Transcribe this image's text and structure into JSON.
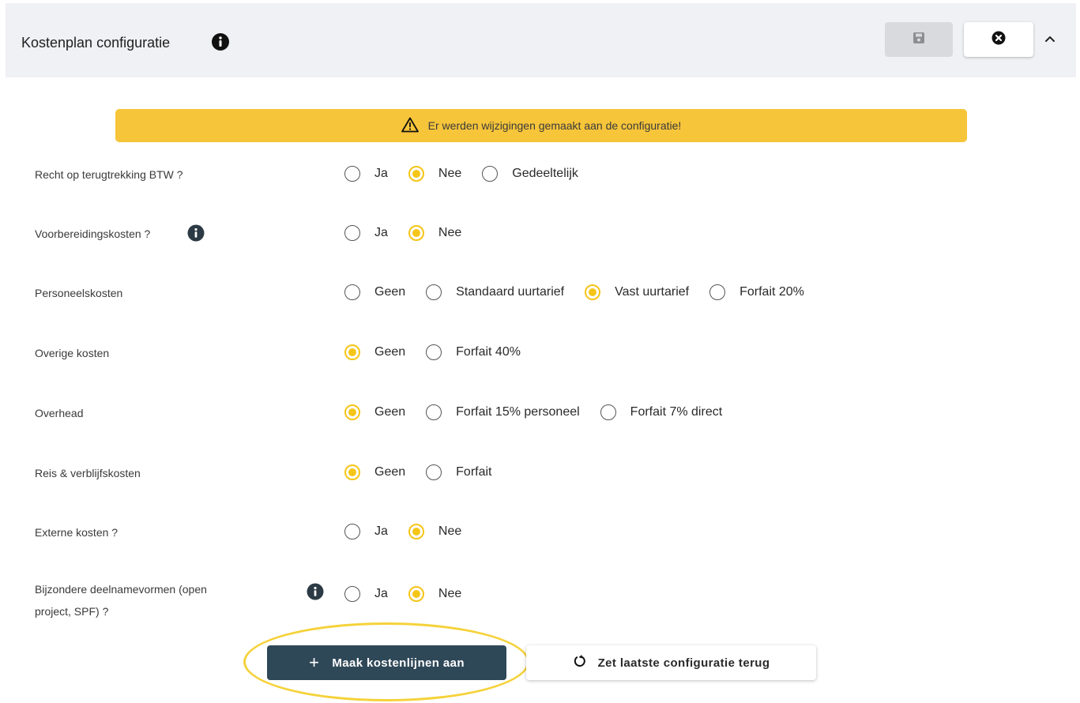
{
  "header": {
    "title": "Kostenplan configuratie",
    "icons": {
      "info": "info-circle-icon",
      "save": "floppy-disk-icon",
      "close": "close-circle-icon",
      "collapse": "chevron-up-icon"
    }
  },
  "warning": {
    "text": "Er werden wijzigingen gemaakt aan de configuratie!",
    "icon": "warning-triangle-icon",
    "color": "#f7c53a"
  },
  "colors": {
    "accent": "#f5c518",
    "primary_button": "#2f4858"
  },
  "rows": [
    {
      "label": "Recht op terugtrekking BTW ?",
      "options": [
        "Ja",
        "Nee",
        "Gedeeltelijk"
      ],
      "selected": "Nee"
    },
    {
      "label": "Voorbereidingskosten ?",
      "options": [
        "Ja",
        "Nee"
      ],
      "selected": "Nee"
    },
    {
      "label": "Personeelskosten",
      "options": [
        "Geen",
        "Standaard uurtarief",
        "Vast uurtarief",
        "Forfait 20%"
      ],
      "selected": "Vast uurtarief"
    },
    {
      "label": "Overige kosten",
      "options": [
        "Geen",
        "Forfait 40%"
      ],
      "selected": "Geen"
    },
    {
      "label": "Overhead",
      "options": [
        "Geen",
        "Forfait 15% personeel",
        "Forfait 7% direct"
      ],
      "selected": "Geen"
    },
    {
      "label": "Reis & verblijfskosten",
      "options": [
        "Geen",
        "Forfait"
      ],
      "selected": "Geen"
    },
    {
      "label": "Externe kosten ?",
      "options": [
        "Ja",
        "Nee"
      ],
      "selected": "Nee"
    },
    {
      "label_line1": "Bijzondere deelnamevormen (open",
      "label_line2": "project, SPF) ?",
      "options": [
        "Ja",
        "Nee"
      ],
      "selected": "Nee"
    }
  ],
  "actions": {
    "create_label": "Maak kostenlijnen aan",
    "create_icon": "plus-icon",
    "revert_label": "Zet laatste configuratie terug",
    "revert_icon": "undo-icon"
  }
}
